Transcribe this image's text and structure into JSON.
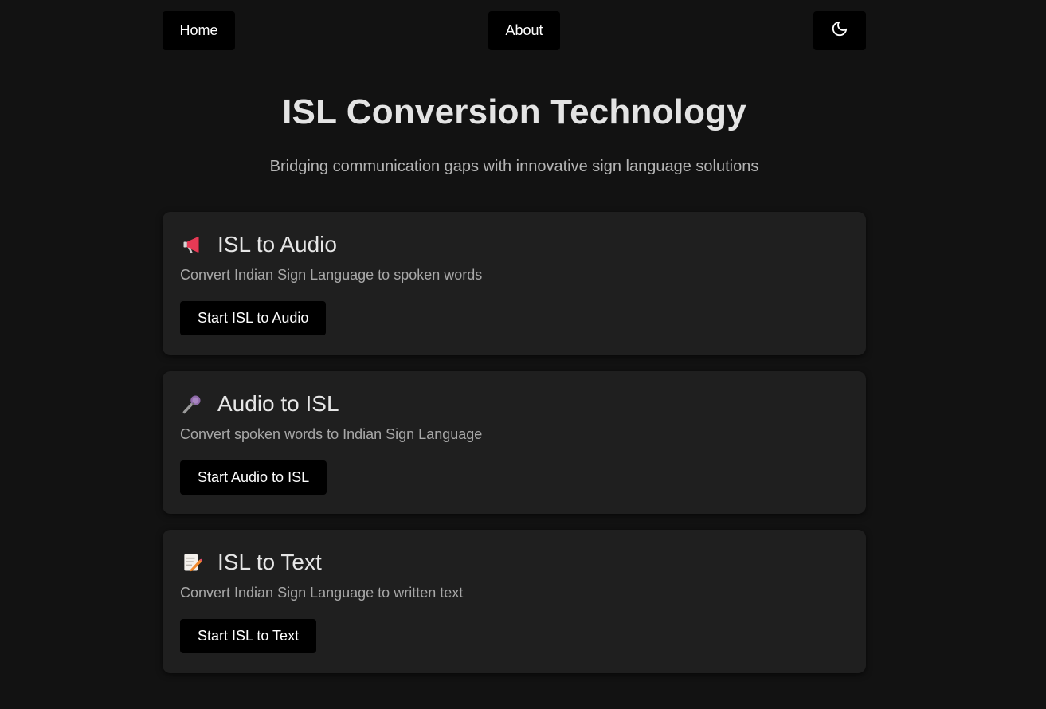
{
  "nav": {
    "home_label": "Home",
    "about_label": "About",
    "theme_icon": "moon-icon"
  },
  "hero": {
    "title": "ISL Conversion Technology",
    "subtitle": "Bridging communication gaps with innovative sign language solutions"
  },
  "cards": [
    {
      "icon": "megaphone-icon",
      "title": "ISL to Audio",
      "description": "Convert Indian Sign Language to spoken words",
      "button_label": "Start ISL to Audio"
    },
    {
      "icon": "microphone-icon",
      "title": "Audio to ISL",
      "description": "Convert spoken words to Indian Sign Language",
      "button_label": "Start Audio to ISL"
    },
    {
      "icon": "memo-icon",
      "title": "ISL to Text",
      "description": "Convert Indian Sign Language to written text",
      "button_label": "Start ISL to Text"
    }
  ],
  "colors": {
    "background": "#121212",
    "card": "#1f1f1f",
    "button": "#000000",
    "text": "#e6e6e6",
    "muted": "#a8a8a8"
  }
}
